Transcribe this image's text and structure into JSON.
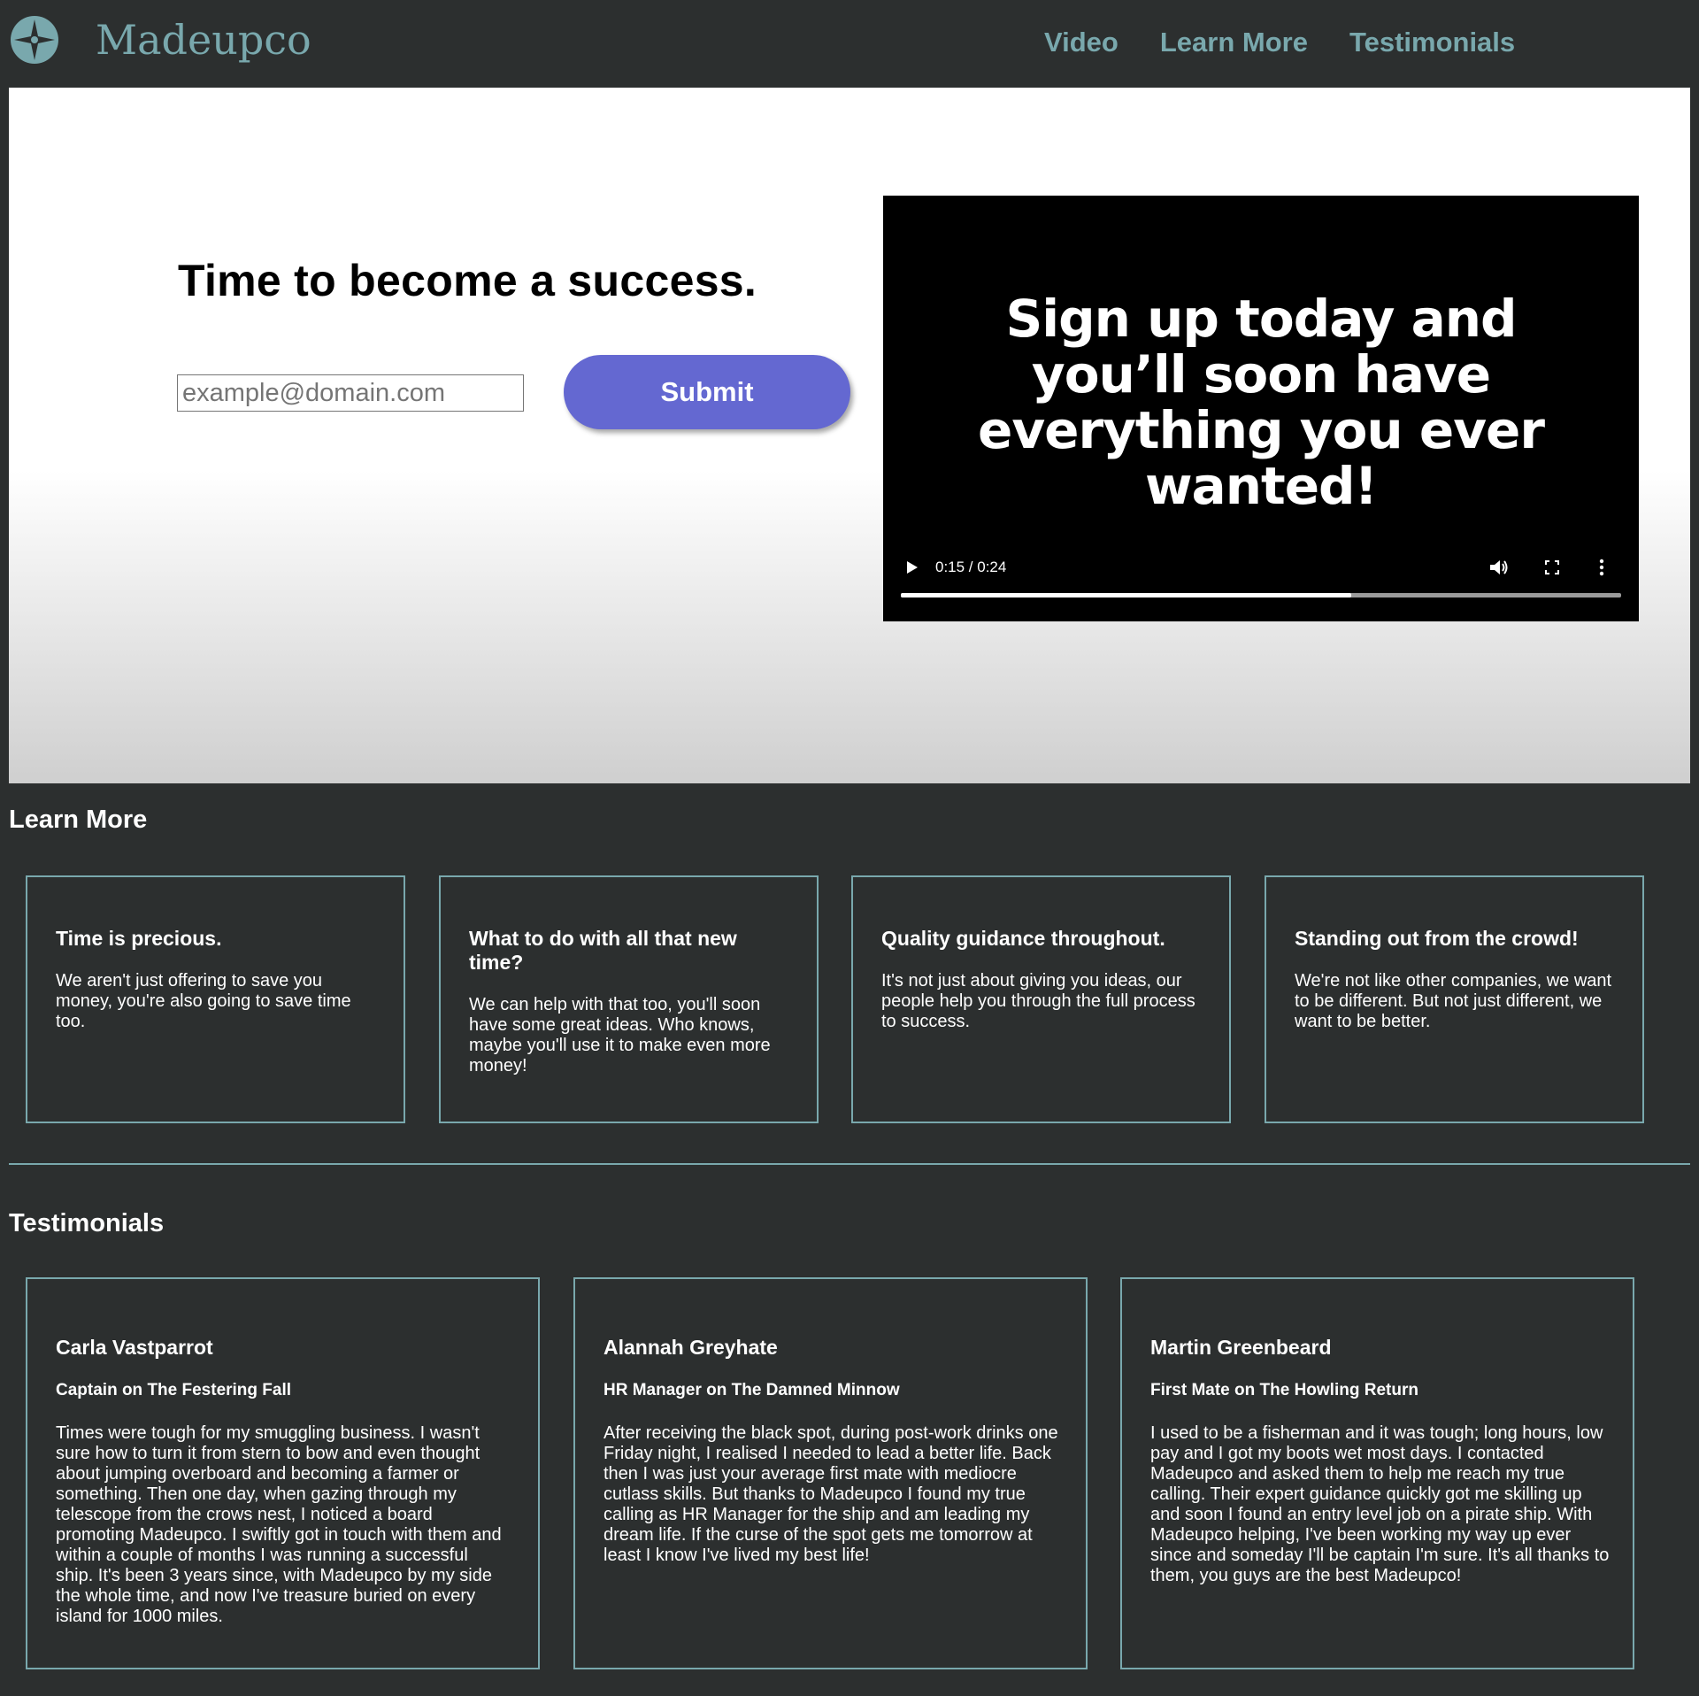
{
  "header": {
    "brand": "Madeupco",
    "nav": [
      "Video",
      "Learn More",
      "Testimonials"
    ],
    "accent_color": "#79a8ad"
  },
  "hero": {
    "title": "Time to become a success.",
    "email_placeholder": "example@domain.com",
    "submit_label": "Submit",
    "button_color": "#6468d1"
  },
  "video": {
    "lines": [
      "Sign up today and",
      "you’ll soon have",
      "everything you ever",
      "wanted!"
    ],
    "time": "0:15 / 0:24",
    "progress_fraction": 0.625
  },
  "learn_more": {
    "title": "Learn More",
    "cards": [
      {
        "heading": "Time is precious.",
        "body": "We aren't just offering to save you money, you're also going to save time too."
      },
      {
        "heading": "What to do with all that new time?",
        "body": "We can help with that too, you'll soon have some great ideas. Who knows, maybe you'll use it to make even more money!"
      },
      {
        "heading": "Quality guidance throughout.",
        "body": "It's not just about giving you ideas, our people help you through the full process to success."
      },
      {
        "heading": "Standing out from the crowd!",
        "body": "We're not like other companies, we want to be different. But not just different, we want to be better."
      }
    ]
  },
  "testimonials": {
    "title": "Testimonials",
    "items": [
      {
        "name": "Carla Vastparrot",
        "role": "Captain on The Festering Fall",
        "body": "Times were tough for my smuggling business. I wasn't sure how to turn it from stern to bow and even thought about jumping overboard and becoming a farmer or something. Then one day, when gazing through my telescope from the crows nest, I noticed a board promoting Madeupco. I swiftly got in touch with them and within a couple of months I was running a successful ship. It's been 3 years since, with Madeupco by my side the whole time, and now I've treasure buried on every island for 1000 miles."
      },
      {
        "name": "Alannah Greyhate",
        "role": "HR Manager on The Damned Minnow",
        "body": "After receiving the black spot, during post-work drinks one Friday night, I realised I needed to lead a better life. Back then I was just your average first mate with mediocre cutlass skills. But thanks to Madeupco I found my true calling as HR Manager for the ship and am leading my dream life. If the curse of the spot gets me tomorrow at least I know I've lived my best life!"
      },
      {
        "name": "Martin Greenbeard",
        "role": "First Mate on The Howling Return",
        "body": "I used to be a fisherman and it was tough; long hours, low pay and I got my boots wet most days. I contacted Madeupco and asked them to help me reach my true calling. Their expert guidance quickly got me skilling up and soon I found an entry level job on a pirate ship. With Madeupco helping, I've been working my way up ever since and someday I'll be captain I'm sure. It's all thanks to them, you guys are the best Madeupco!"
      }
    ]
  }
}
